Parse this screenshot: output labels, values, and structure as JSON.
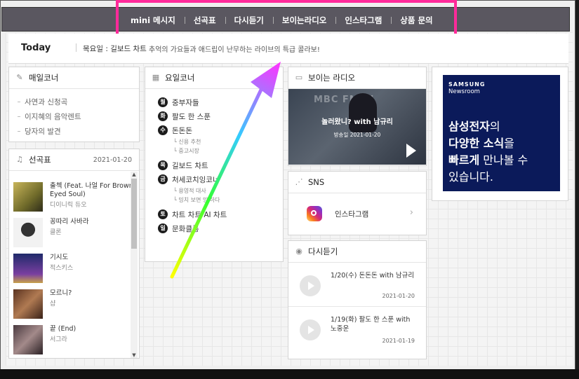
{
  "nav": {
    "items": [
      "mini 메시지",
      "선곡표",
      "다시듣기",
      "보이는라디오",
      "인스타그램",
      "상품 문의"
    ]
  },
  "today": {
    "title": "Today",
    "label": "목요일 : 길보드 차트",
    "description": "추억의 가요들과 애드립이 난무하는 라이브의 특급 콜라보!"
  },
  "daily_corner": {
    "title": "매일코너",
    "items": [
      "사연과 신청곡",
      "이지혜의 음악렌트",
      "당자의 발견"
    ]
  },
  "playlist": {
    "title": "선곡표",
    "date": "2021-01-20",
    "songs": [
      {
        "title": "출첵 (Feat. 나얼 For Brown Eyed Soul)",
        "artist": "디이니릭 듀오"
      },
      {
        "title": "꽁따리 사바라",
        "artist": "클론"
      },
      {
        "title": "기시도",
        "artist": "적스키스"
      },
      {
        "title": "모르니?",
        "artist": "샵"
      },
      {
        "title": "끝 (End)",
        "artist": "서그라"
      }
    ]
  },
  "weekly_corner": {
    "title": "요일코너",
    "days": [
      {
        "badge": "월",
        "label": "중부자들",
        "subs": []
      },
      {
        "badge": "화",
        "label": "팔도 한 스푼",
        "subs": []
      },
      {
        "badge": "수",
        "label": "돈돈돈",
        "subs": [
          "신용 추천",
          "중고시장"
        ]
      },
      {
        "badge": "목",
        "label": "길보드 차트",
        "subs": []
      },
      {
        "badge": "금",
        "label": "처세코치잉코너",
        "subs": [
          "용영적 대사",
          "밍치 보면 밍 하다"
        ]
      },
      {
        "badge": "토",
        "label": "차트 차트 AI 차트",
        "subs": []
      },
      {
        "badge": "일",
        "label": "문화클롱",
        "subs": []
      }
    ]
  },
  "visible_radio": {
    "title": "보이는 라디오",
    "overlay_title": "놀러왔니? with 남규리",
    "overlay_date": "방송일 2021-01-20",
    "bg_text": "MBC FM4U"
  },
  "sns": {
    "title": "SNS",
    "instagram_label": "인스타그램"
  },
  "replay": {
    "title": "다시듣기",
    "items": [
      {
        "title": "1/20(수) 돈돈돈 with 남규리",
        "date": "2021-01-20"
      },
      {
        "title": "1/19(화) 팔도 한 스푼 with 노중운",
        "date": "2021-01-19"
      }
    ]
  },
  "ad": {
    "brand_line1": "SAMSUNG",
    "brand_line2": "Newsroom",
    "line1a": "삼성전자",
    "line1b": "의",
    "line2a": "다양한 소식",
    "line2b": "을",
    "line3a": "빠르게",
    "line3b": " 만나볼 수",
    "line4": "있습니다."
  },
  "colors": {
    "topbar": "#5a5760",
    "highlight_border": "#ff2a9a",
    "ad_bg": "#0b1a5a"
  }
}
